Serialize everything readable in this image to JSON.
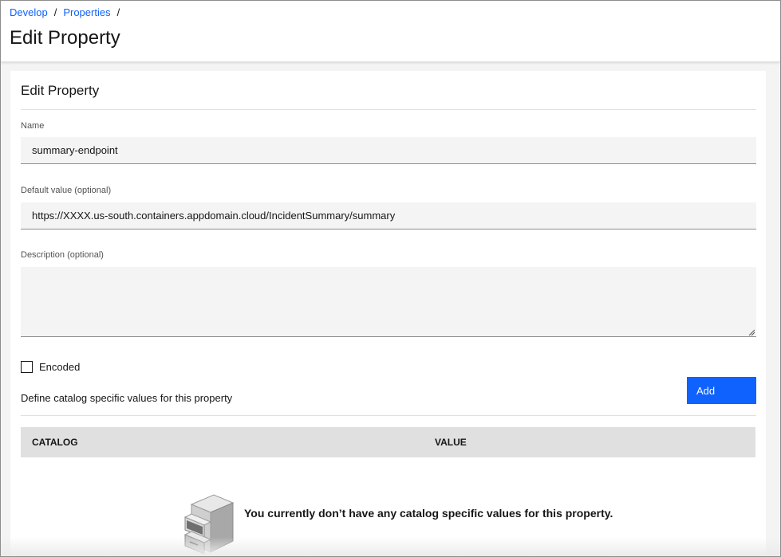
{
  "breadcrumb": {
    "items": [
      "Develop",
      "Properties"
    ],
    "separator": "/"
  },
  "page_title": "Edit Property",
  "form": {
    "title": "Edit Property",
    "name": {
      "label": "Name",
      "value": "summary-endpoint"
    },
    "default_value": {
      "label": "Default value (optional)",
      "value": "https://XXXX.us-south.containers.appdomain.cloud/IncidentSummary/summary"
    },
    "description": {
      "label": "Description (optional)",
      "value": ""
    },
    "encoded": {
      "label": "Encoded",
      "checked": false
    }
  },
  "catalog": {
    "description": "Define catalog specific values for this property",
    "add_label": "Add",
    "columns": [
      "CATALOG",
      "VALUE"
    ],
    "empty_message": "You currently don’t have any catalog specific values for this property.",
    "empty_icon": "filing-cabinet-icon"
  },
  "colors": {
    "link": "#0f62fe",
    "primary_button": "#0f62fe",
    "table_header": "#e0e0e0",
    "input_bg": "#f4f4f4"
  }
}
